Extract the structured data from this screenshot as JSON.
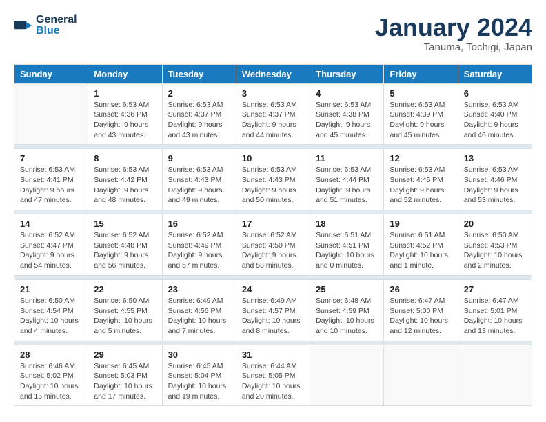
{
  "header": {
    "logo_line1": "General",
    "logo_line2": "Blue",
    "month_title": "January 2024",
    "location": "Tanuma, Tochigi, Japan"
  },
  "days_of_week": [
    "Sunday",
    "Monday",
    "Tuesday",
    "Wednesday",
    "Thursday",
    "Friday",
    "Saturday"
  ],
  "weeks": [
    [
      {
        "num": "",
        "detail": ""
      },
      {
        "num": "1",
        "detail": "Sunrise: 6:53 AM\nSunset: 4:36 PM\nDaylight: 9 hours\nand 43 minutes."
      },
      {
        "num": "2",
        "detail": "Sunrise: 6:53 AM\nSunset: 4:37 PM\nDaylight: 9 hours\nand 43 minutes."
      },
      {
        "num": "3",
        "detail": "Sunrise: 6:53 AM\nSunset: 4:37 PM\nDaylight: 9 hours\nand 44 minutes."
      },
      {
        "num": "4",
        "detail": "Sunrise: 6:53 AM\nSunset: 4:38 PM\nDaylight: 9 hours\nand 45 minutes."
      },
      {
        "num": "5",
        "detail": "Sunrise: 6:53 AM\nSunset: 4:39 PM\nDaylight: 9 hours\nand 45 minutes."
      },
      {
        "num": "6",
        "detail": "Sunrise: 6:53 AM\nSunset: 4:40 PM\nDaylight: 9 hours\nand 46 minutes."
      }
    ],
    [
      {
        "num": "7",
        "detail": "Sunrise: 6:53 AM\nSunset: 4:41 PM\nDaylight: 9 hours\nand 47 minutes."
      },
      {
        "num": "8",
        "detail": "Sunrise: 6:53 AM\nSunset: 4:42 PM\nDaylight: 9 hours\nand 48 minutes."
      },
      {
        "num": "9",
        "detail": "Sunrise: 6:53 AM\nSunset: 4:43 PM\nDaylight: 9 hours\nand 49 minutes."
      },
      {
        "num": "10",
        "detail": "Sunrise: 6:53 AM\nSunset: 4:43 PM\nDaylight: 9 hours\nand 50 minutes."
      },
      {
        "num": "11",
        "detail": "Sunrise: 6:53 AM\nSunset: 4:44 PM\nDaylight: 9 hours\nand 51 minutes."
      },
      {
        "num": "12",
        "detail": "Sunrise: 6:53 AM\nSunset: 4:45 PM\nDaylight: 9 hours\nand 52 minutes."
      },
      {
        "num": "13",
        "detail": "Sunrise: 6:53 AM\nSunset: 4:46 PM\nDaylight: 9 hours\nand 53 minutes."
      }
    ],
    [
      {
        "num": "14",
        "detail": "Sunrise: 6:52 AM\nSunset: 4:47 PM\nDaylight: 9 hours\nand 54 minutes."
      },
      {
        "num": "15",
        "detail": "Sunrise: 6:52 AM\nSunset: 4:48 PM\nDaylight: 9 hours\nand 56 minutes."
      },
      {
        "num": "16",
        "detail": "Sunrise: 6:52 AM\nSunset: 4:49 PM\nDaylight: 9 hours\nand 57 minutes."
      },
      {
        "num": "17",
        "detail": "Sunrise: 6:52 AM\nSunset: 4:50 PM\nDaylight: 9 hours\nand 58 minutes."
      },
      {
        "num": "18",
        "detail": "Sunrise: 6:51 AM\nSunset: 4:51 PM\nDaylight: 10 hours\nand 0 minutes."
      },
      {
        "num": "19",
        "detail": "Sunrise: 6:51 AM\nSunset: 4:52 PM\nDaylight: 10 hours\nand 1 minute."
      },
      {
        "num": "20",
        "detail": "Sunrise: 6:50 AM\nSunset: 4:53 PM\nDaylight: 10 hours\nand 2 minutes."
      }
    ],
    [
      {
        "num": "21",
        "detail": "Sunrise: 6:50 AM\nSunset: 4:54 PM\nDaylight: 10 hours\nand 4 minutes."
      },
      {
        "num": "22",
        "detail": "Sunrise: 6:50 AM\nSunset: 4:55 PM\nDaylight: 10 hours\nand 5 minutes."
      },
      {
        "num": "23",
        "detail": "Sunrise: 6:49 AM\nSunset: 4:56 PM\nDaylight: 10 hours\nand 7 minutes."
      },
      {
        "num": "24",
        "detail": "Sunrise: 6:49 AM\nSunset: 4:57 PM\nDaylight: 10 hours\nand 8 minutes."
      },
      {
        "num": "25",
        "detail": "Sunrise: 6:48 AM\nSunset: 4:59 PM\nDaylight: 10 hours\nand 10 minutes."
      },
      {
        "num": "26",
        "detail": "Sunrise: 6:47 AM\nSunset: 5:00 PM\nDaylight: 10 hours\nand 12 minutes."
      },
      {
        "num": "27",
        "detail": "Sunrise: 6:47 AM\nSunset: 5:01 PM\nDaylight: 10 hours\nand 13 minutes."
      }
    ],
    [
      {
        "num": "28",
        "detail": "Sunrise: 6:46 AM\nSunset: 5:02 PM\nDaylight: 10 hours\nand 15 minutes."
      },
      {
        "num": "29",
        "detail": "Sunrise: 6:45 AM\nSunset: 5:03 PM\nDaylight: 10 hours\nand 17 minutes."
      },
      {
        "num": "30",
        "detail": "Sunrise: 6:45 AM\nSunset: 5:04 PM\nDaylight: 10 hours\nand 19 minutes."
      },
      {
        "num": "31",
        "detail": "Sunrise: 6:44 AM\nSunset: 5:05 PM\nDaylight: 10 hours\nand 20 minutes."
      },
      {
        "num": "",
        "detail": ""
      },
      {
        "num": "",
        "detail": ""
      },
      {
        "num": "",
        "detail": ""
      }
    ]
  ]
}
